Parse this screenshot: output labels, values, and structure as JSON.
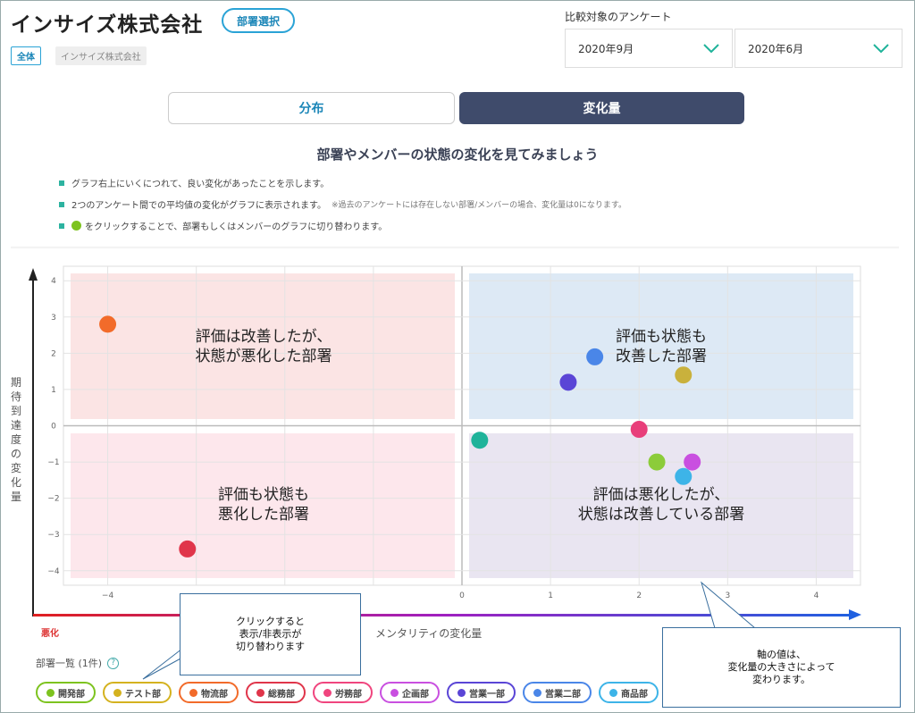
{
  "header": {
    "company": "インサイズ株式会社",
    "dept_select": "部署選択",
    "tag_all": "全体",
    "tag_company": "インサイズ株式会社"
  },
  "compare": {
    "label": "比較対象のアンケート",
    "current": "2020年9月",
    "previous": "2020年6月"
  },
  "tabs": [
    {
      "label": "分布"
    },
    {
      "label": "変化量"
    }
  ],
  "intro": {
    "heading": "部署やメンバーの状態の変化を見てみましょう",
    "bullets": [
      {
        "text": "グラフ右上にいくにつれて、良い変化があったことを示します。"
      },
      {
        "text": "2つのアンケート間での平均値の変化がグラフに表示されます。",
        "note": "※過去のアンケートには存在しない部署/メンバーの場合、変化量は0になります。"
      },
      {
        "text": "をクリックすることで、部署もしくはメンバーのグラフに切り替わります。"
      }
    ]
  },
  "chart_data": {
    "type": "scatter",
    "xlabel": "メンタリティの変化量",
    "ylabel": "期待到達度の変化量",
    "xlim": [
      -4.5,
      4.5
    ],
    "ylim": [
      -4.4,
      4.4
    ],
    "xticks": [
      -4,
      -3,
      -2,
      -1,
      0,
      1,
      2,
      3,
      4
    ],
    "yticks": [
      4,
      3,
      2,
      1,
      0,
      -1,
      -2,
      -3,
      -4
    ],
    "xtick_labels": [
      "−4",
      "",
      "",
      "",
      "0",
      "1",
      "2",
      "3",
      "4"
    ],
    "ytick_labels": [
      "4",
      "3",
      "2",
      "1",
      "0",
      "−1",
      "−2",
      "−3",
      "−4"
    ],
    "axis_left_label": "悪化",
    "grid": true,
    "quadrants": [
      {
        "text1": "評価は改善したが、",
        "text2": "状態が悪化した部署",
        "color": "#fbe4e4"
      },
      {
        "text1": "評価も状態も",
        "text2": "改善した部署",
        "color": "#dde9f5"
      },
      {
        "text1": "評価も状態も",
        "text2": "悪化した部署",
        "color": "#fde7ec"
      },
      {
        "text1": "評価は悪化したが、",
        "text2": "状態は改善している部署",
        "color": "#e9e5f1"
      }
    ],
    "points": [
      {
        "x": -4.0,
        "y": 2.8,
        "color": "#f26b2a"
      },
      {
        "x": 1.5,
        "y": 1.9,
        "color": "#4a86e8"
      },
      {
        "x": 1.2,
        "y": 1.2,
        "color": "#5a45d6"
      },
      {
        "x": 2.5,
        "y": 1.4,
        "color": "#c9b13c"
      },
      {
        "x": 0.2,
        "y": -0.4,
        "color": "#1fb39a"
      },
      {
        "x": 2.0,
        "y": -0.1,
        "color": "#e83e7a"
      },
      {
        "x": 2.2,
        "y": -1.0,
        "color": "#8ccc3a"
      },
      {
        "x": 2.6,
        "y": -1.0,
        "color": "#c94fe0"
      },
      {
        "x": 2.5,
        "y": -1.4,
        "color": "#3db4e8"
      },
      {
        "x": -3.1,
        "y": -3.4,
        "color": "#e0354a"
      }
    ]
  },
  "callouts": {
    "click": [
      "クリックすると",
      "表示/非表示が",
      "切り替わります"
    ],
    "axis": [
      "軸の値は、",
      "変化量の大きさによって",
      "変わります。"
    ]
  },
  "departments": {
    "title": "部署一覧 (1件)",
    "help": "?",
    "items": [
      {
        "label": "開発部",
        "color": "#7dc31f"
      },
      {
        "label": "テスト部",
        "color": "#d4b21f"
      },
      {
        "label": "物流部",
        "color": "#f26b2a"
      },
      {
        "label": "総務部",
        "color": "#e0354a"
      },
      {
        "label": "労務部",
        "color": "#f0457e"
      },
      {
        "label": "企画部",
        "color": "#c94fe0"
      },
      {
        "label": "営業一部",
        "color": "#5a45d6"
      },
      {
        "label": "営業二部",
        "color": "#4a86e8"
      },
      {
        "label": "商品部",
        "color": "#3db4e8"
      }
    ]
  }
}
